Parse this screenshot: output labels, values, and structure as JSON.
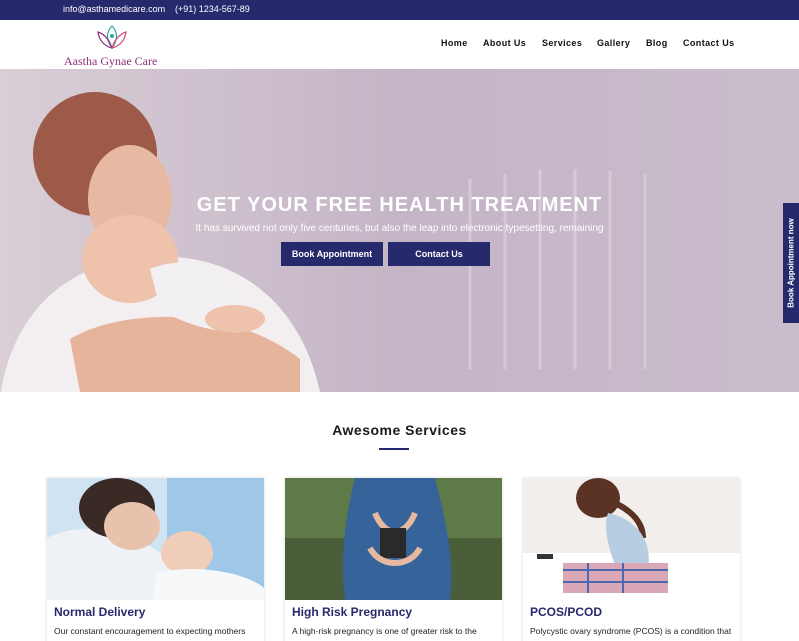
{
  "topbar": {
    "email": "info@asthamedicare.com",
    "phone": "(+91) 1234-567-89"
  },
  "brand": {
    "name": "Aastha Gynae Care",
    "logo_icon": "lotus-icon"
  },
  "nav": {
    "items": [
      "Home",
      "About Us",
      "Services",
      "Gallery",
      "Blog",
      "Contact Us"
    ]
  },
  "hero": {
    "title": "GET YOUR FREE HEALTH TREATMENT",
    "subtitle": "It has survived not only five centuries, but also the leap into electronic typesetting, remaining",
    "book_label": "Book Appointment",
    "contact_label": "Contact Us",
    "side_tab": "Book Appointment now"
  },
  "services": {
    "title": "Awesome Services",
    "cards": [
      {
        "title": "Normal Delivery",
        "text": "Our constant encouragement to expecting mothers"
      },
      {
        "title": "High Risk Pregnancy",
        "text": "A high-risk pregnancy is one of greater risk to the"
      },
      {
        "title": "PCOS/PCOD",
        "text": "Polycystic ovary syndrome (PCOS) is a condition that"
      }
    ]
  },
  "colors": {
    "brand": "#27296d",
    "logo": "#8e2f7c"
  }
}
